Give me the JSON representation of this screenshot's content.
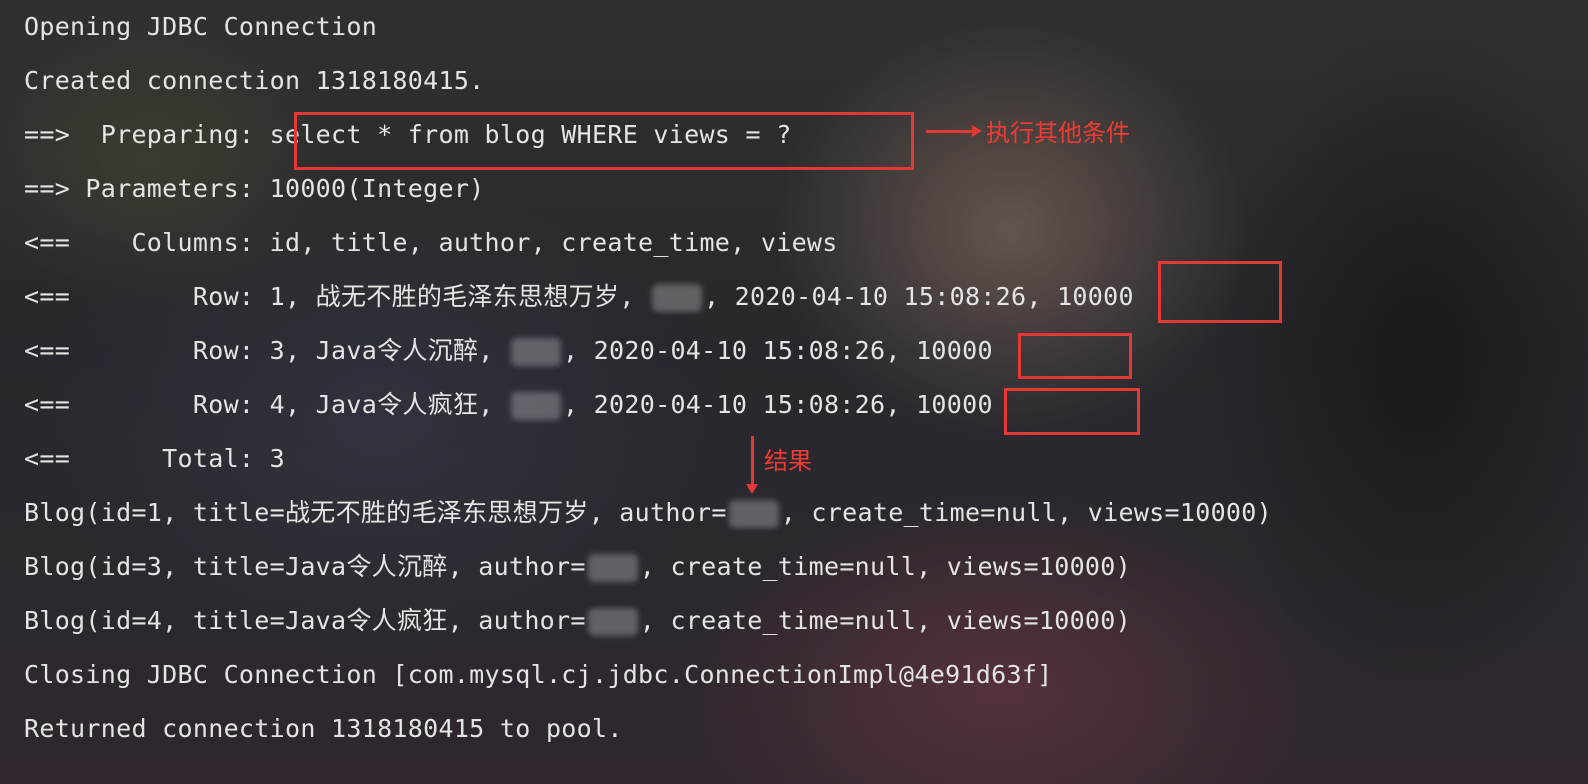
{
  "console": {
    "lines": [
      {
        "text": "Opening JDBC Connection"
      },
      {
        "text": "Created connection 1318180415."
      },
      {
        "text": "==>  Preparing: select * from blog WHERE views = ?"
      },
      {
        "text": "==> Parameters: 10000(Integer)"
      },
      {
        "text": "<==    Columns: id, title, author, create_time, views"
      },
      {
        "before": "<==        Row: 1, 战无不胜的毛泽东思想万岁, ",
        "after": ", 2020-04-10 15:08:26, 10000"
      },
      {
        "before": "<==        Row: 3, Java令人沉醉, ",
        "after": ", 2020-04-10 15:08:26, 10000"
      },
      {
        "before": "<==        Row: 4, Java令人疯狂, ",
        "after": ", 2020-04-10 15:08:26, 10000"
      },
      {
        "text": "<==      Total: 3"
      },
      {
        "before": "Blog(id=1, title=战无不胜的毛泽东思想万岁, author=",
        "after": ", create_time=null, views=10000)"
      },
      {
        "before": "Blog(id=3, title=Java令人沉醉, author=",
        "after": ", create_time=null, views=10000)"
      },
      {
        "before": "Blog(id=4, title=Java令人疯狂, author=",
        "after": ", create_time=null, views=10000)"
      },
      {
        "text": "Closing JDBC Connection [com.mysql.cj.jdbc.ConnectionImpl@4e91d63f]"
      },
      {
        "text": "Returned connection 1318180415 to pool."
      }
    ]
  },
  "annotations": {
    "other_conditions_label": "执行其他条件",
    "result_label": "结果",
    "color": "#e53935"
  },
  "colors": {
    "console_text": "#e4e4e4",
    "highlight": "#e53935"
  }
}
